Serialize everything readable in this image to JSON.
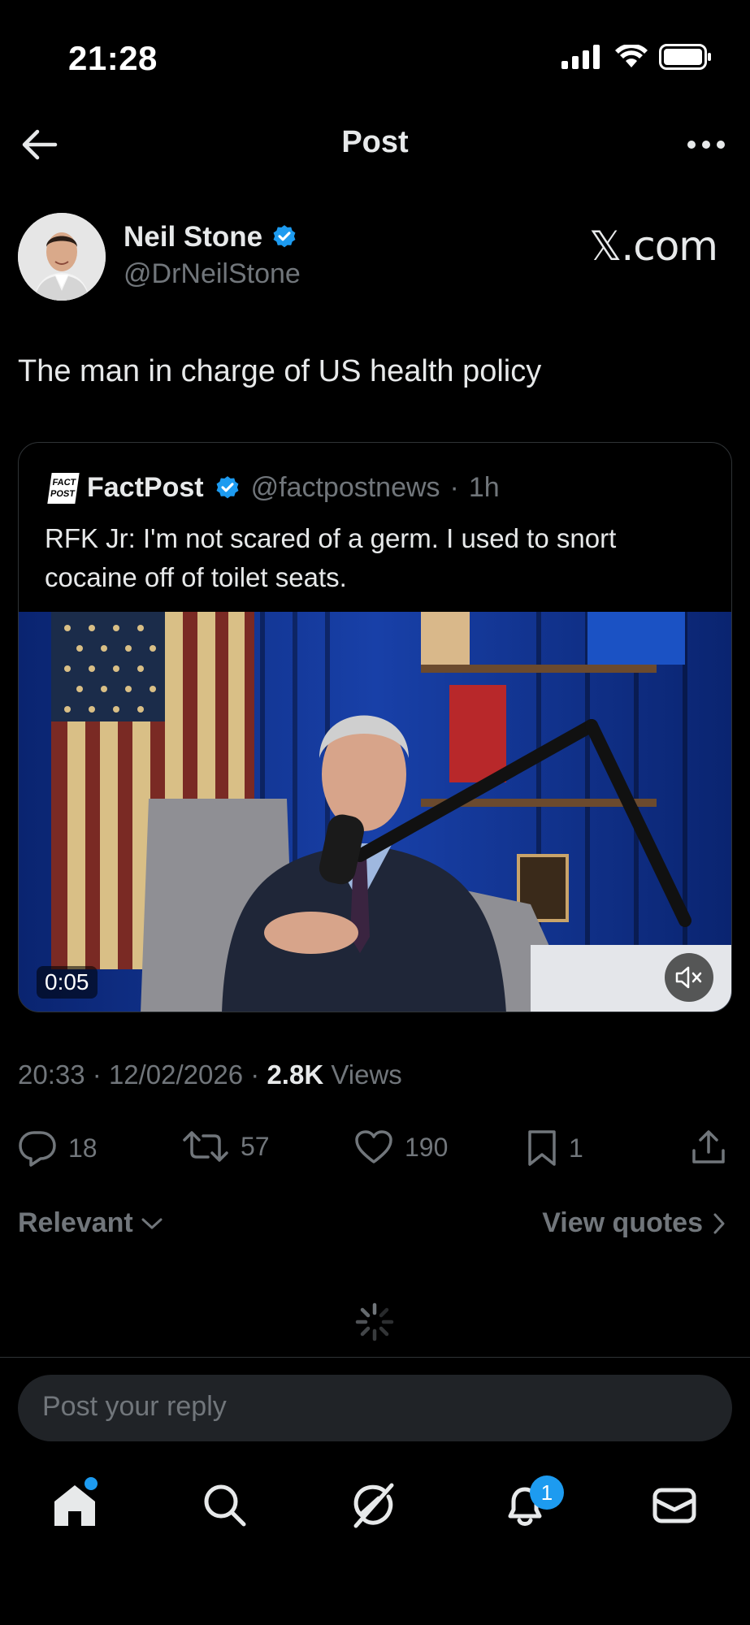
{
  "status_bar": {
    "time": "21:28"
  },
  "header": {
    "title": "Post"
  },
  "author": {
    "name": "Neil Stone",
    "handle": "@DrNeilStone",
    "watermark": "𝕏.com"
  },
  "post": {
    "text": "The man in charge of US health policy"
  },
  "quote": {
    "logo_text_1": "FACT",
    "logo_text_2": "POST",
    "name": "FactPost",
    "handle": "@factpostnews",
    "time": "1h",
    "text": "RFK Jr: I'm not scared of a germ. I used to snort cocaine off of toilet seats.",
    "video_time": "0:05"
  },
  "meta": {
    "time": "20:33",
    "date": "12/02/2026",
    "views_count": "2.8K",
    "views_label": "Views"
  },
  "actions": {
    "replies": "18",
    "reposts": "57",
    "likes": "190",
    "bookmarks": "1"
  },
  "sort": {
    "relevant_label": "Relevant",
    "view_quotes_label": "View quotes"
  },
  "reply": {
    "placeholder": "Post your reply"
  },
  "tabbar": {
    "notifications_badge": "1"
  },
  "colors": {
    "accent": "#1d9bf0",
    "background": "#000000",
    "muted": "#71767b",
    "text": "#e7e9ea"
  }
}
